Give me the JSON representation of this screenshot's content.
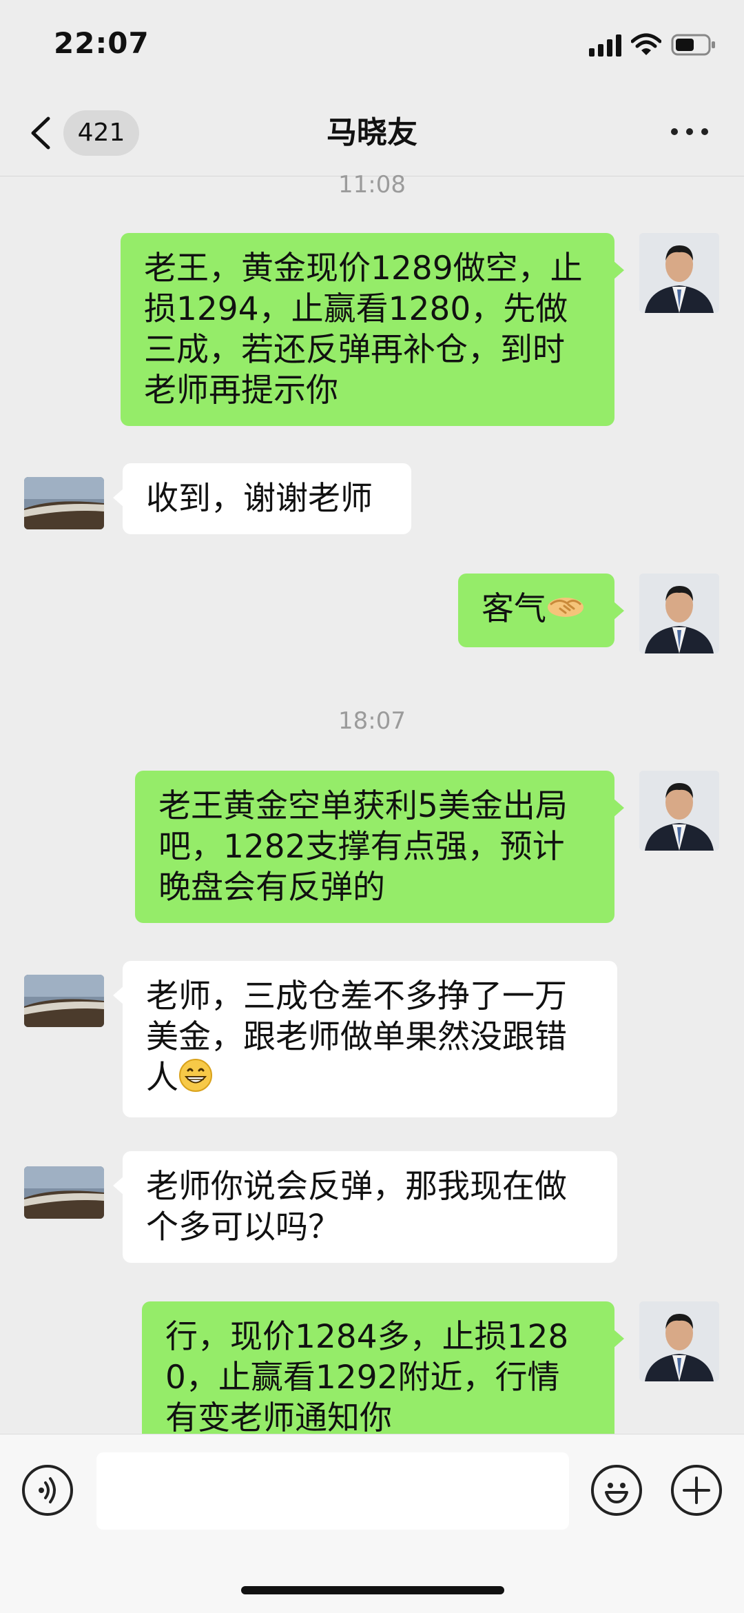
{
  "status_bar": {
    "time": "22:07",
    "signal_icon": "cellular-signal-icon",
    "wifi_icon": "wifi-icon",
    "battery_icon": "battery-icon"
  },
  "nav": {
    "back_icon": "chevron-left-icon",
    "unread_count": "421",
    "title": "马晓友",
    "more_icon": "ellipsis-icon"
  },
  "timestamps": [
    "11:08",
    "18:07"
  ],
  "messages": [
    {
      "side": "out",
      "text": "老王，黄金现价1289做空，止损1294，止赢看1280，先做三成，若还反弹再补仓，到时老师再提示你"
    },
    {
      "side": "in",
      "text": "收到，谢谢老师"
    },
    {
      "side": "out",
      "text": "客气",
      "emoji": "handshake-emoji"
    },
    {
      "side": "out",
      "text": "老王黄金空单获利5美金出局吧，1282支撑有点强，预计晚盘会有反弹的"
    },
    {
      "side": "in",
      "text": "老师，三成仓差不多挣了一万美金，跟老师做单果然没跟错人",
      "emoji": "grinning-emoji"
    },
    {
      "side": "in",
      "text": "老师你说会反弹，那我现在做个多可以吗？"
    },
    {
      "side": "out",
      "text": "行，现价1284多，止损1280，止赢看1292附近，行情有变老师通知你"
    }
  ],
  "input_bar": {
    "voice_icon": "voice-input-icon",
    "emoji_icon": "emoji-icon",
    "plus_icon": "plus-icon",
    "text_value": ""
  },
  "colors": {
    "outgoing_bubble": "#95ec69",
    "incoming_bubble": "#ffffff",
    "background": "#ededed"
  }
}
